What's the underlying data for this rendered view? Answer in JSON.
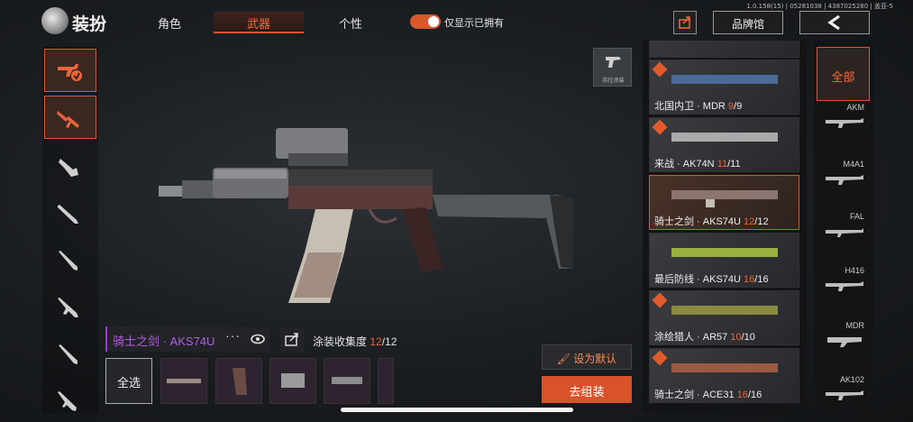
{
  "version": "1.0.158(15) | 05281038 | 4387025280 | 盖亚-5",
  "header": {
    "title": "装扮",
    "tabs": [
      {
        "label": "角色",
        "active": false
      },
      {
        "label": "武器",
        "active": true
      },
      {
        "label": "个性",
        "active": false
      }
    ],
    "toggle_label": "仅显示已拥有",
    "toggle_on": true,
    "brand_label": "品牌馆"
  },
  "weapon": {
    "skin_name": "骑士之剑 · AKS74U",
    "collection_label": "涂装收集度",
    "collection_owned": "12",
    "collection_total": "/12",
    "goto_paint_label": "前往涂装"
  },
  "actions": {
    "select_all": "全选",
    "set_default": "设为默认",
    "go_assemble": "去组装"
  },
  "skins": [
    {
      "name": "北国内卫 · MDR ",
      "owned": "9",
      "total": "/9",
      "selected": false
    },
    {
      "name": "来战 · AK74N ",
      "owned": "11",
      "total": "/11",
      "selected": false
    },
    {
      "name": "骑士之剑 · AKS74U ",
      "owned": "12",
      "total": "/12",
      "selected": true
    },
    {
      "name": "最后防线 · AKS74U ",
      "owned": "16",
      "total": "/16",
      "selected": false
    },
    {
      "name": "涂绘猎人 · AR57 ",
      "owned": "10",
      "total": "/10",
      "selected": false
    },
    {
      "name": "骑士之剑 · ACE31 ",
      "owned": "16",
      "total": "/16",
      "selected": false
    }
  ],
  "filters": {
    "all_label": "全部",
    "items": [
      "AKM",
      "M4A1",
      "FAL",
      "H416",
      "MDR",
      "AK102"
    ]
  },
  "colors": {
    "accent": "#d9582c",
    "purple_rarity": "#b45fe6"
  }
}
